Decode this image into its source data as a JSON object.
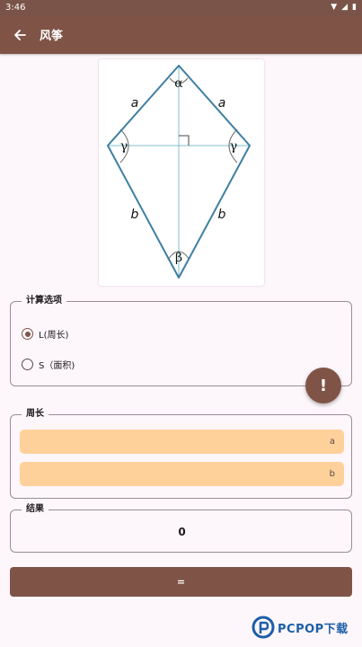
{
  "status_bar": {
    "time": "3:46"
  },
  "app_bar": {
    "title": "风筝"
  },
  "diagram": {
    "labels": {
      "alpha": "α",
      "beta": "β",
      "gamma_left": "γ",
      "gamma_right": "γ",
      "a_left": "a",
      "a_right": "a",
      "b_left": "b",
      "b_right": "b"
    },
    "colors": {
      "edge": "#3f7fa2",
      "axis": "#7fc0cf",
      "arc": "#6b6b6b"
    }
  },
  "options": {
    "legend": "计算选项",
    "items": [
      {
        "label": "L(周长)",
        "checked": true
      },
      {
        "label": "S（面积)",
        "checked": false
      }
    ]
  },
  "fab": {
    "label": "!"
  },
  "perimeter": {
    "legend": "周长",
    "fields": [
      {
        "placeholder": "a"
      },
      {
        "placeholder": "b"
      }
    ]
  },
  "result": {
    "legend": "结果",
    "value": "0"
  },
  "calculate": {
    "label": "="
  },
  "watermark": {
    "text": "PCPOP下载"
  },
  "colors": {
    "primary": "#7f5447",
    "input_bg": "#ffd19a",
    "background": "#fdf6fb"
  }
}
